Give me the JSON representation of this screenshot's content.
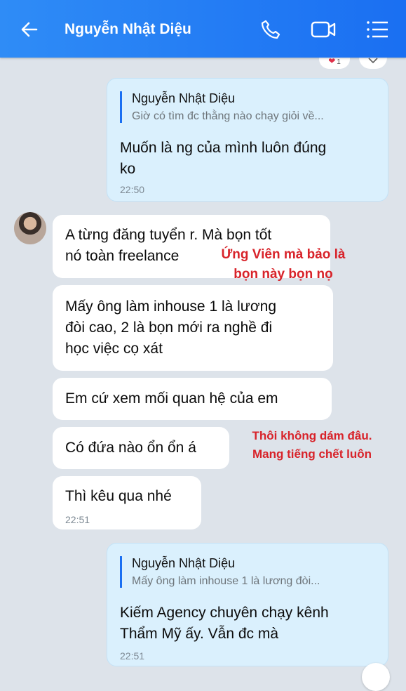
{
  "header": {
    "contact_name": "Nguyễn Nhật Diệu",
    "icons": [
      "back-arrow-icon",
      "phone-icon",
      "video-call-icon",
      "list-menu-icon"
    ]
  },
  "reactions": {
    "heart_count": "1"
  },
  "messages": {
    "m1": {
      "quote_name": "Nguyễn Nhật Diệu",
      "quote_text": "Giờ có tìm đc thằng nào chạy giỏi về...",
      "line1": "Muốn là ng của mình luôn đúng",
      "line2": "ko",
      "time": "22:50"
    },
    "m2": {
      "line1": "A từng đăng tuyển r. Mà bọn tốt",
      "line2": "nó toàn freelance"
    },
    "m3": {
      "line1": "Mấy ông làm inhouse 1 là lương",
      "line2": "đòi cao, 2 là bọn mới ra nghề đi",
      "line3": "học việc cọ xát"
    },
    "m4": {
      "text": "Em cứ xem mối quan hệ của em"
    },
    "m5": {
      "text": "Có đứa nào ổn ổn á"
    },
    "m6": {
      "text": "Thì kêu qua nhé",
      "time": "22:51"
    },
    "m7": {
      "quote_name": "Nguyễn Nhật Diệu",
      "quote_text": "Mấy ông làm inhouse 1 là lương đòi...",
      "line1": "Kiếm Agency chuyên chạy kênh",
      "line2": "Thẩm Mỹ ấy. Vẫn đc mà",
      "time": "22:51"
    }
  },
  "annotations": {
    "a1_line1": "Ứng Viên mà bảo là",
    "a1_line2": "bọn này bọn nọ",
    "a2_line1": "Thôi không dám đâu.",
    "a2_line2": "Mang tiếng chết luôn"
  },
  "colors": {
    "header": "#1a6ff2",
    "background": "#dde3ea",
    "outgoing_bubble": "#daf0fd",
    "incoming_bubble": "#ffffff",
    "annotation": "#d8232a"
  }
}
